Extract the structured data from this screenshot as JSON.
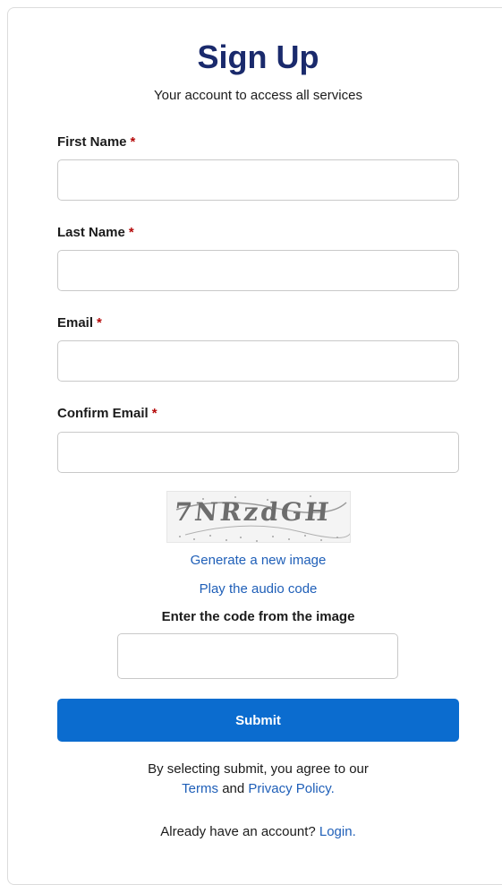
{
  "header": {
    "title": "Sign Up",
    "subtitle": "Your account to access all services"
  },
  "form": {
    "required_mark": "*",
    "first_name": {
      "label": "First Name",
      "value": "",
      "placeholder": ""
    },
    "last_name": {
      "label": "Last Name",
      "value": "",
      "placeholder": ""
    },
    "email": {
      "label": "Email",
      "value": "",
      "placeholder": ""
    },
    "confirm_email": {
      "label": "Confirm Email",
      "value": "",
      "placeholder": ""
    }
  },
  "captcha": {
    "image_text": "7NRzdGH",
    "new_image_link": "Generate a new image",
    "audio_link": "Play the audio code",
    "code_label": "Enter the code from the image",
    "code_value": ""
  },
  "actions": {
    "submit_label": "Submit"
  },
  "footer": {
    "agree_text": "By selecting submit, you agree to our",
    "terms_link": "Terms",
    "and_text": "and",
    "privacy_link": "Privacy Policy.",
    "already_text": "Already have an account?",
    "login_link": "Login."
  },
  "colors": {
    "title": "#1a2a6c",
    "link": "#1f5fb8",
    "submit_bg": "#0b6ccf",
    "required": "#b50909"
  }
}
